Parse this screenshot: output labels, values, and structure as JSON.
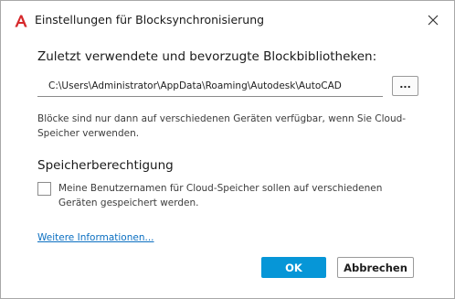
{
  "window": {
    "title": "Einstellungen für Blocksynchronisierung",
    "app_icon": "autocad-a-icon",
    "close_icon": "close-icon"
  },
  "library": {
    "heading": "Zuletzt verwendete und bevorzugte Blockbibliotheken:",
    "path_value": "C:\\Users\\Administrator\\AppData\\Roaming\\Autodesk\\AutoCAD",
    "browse_label": "...",
    "info": "Blöcke sind nur dann auf verschiedenen Geräten verfügbar, wenn Sie Cloud-Speicher verwenden."
  },
  "permission": {
    "heading": "Speicherberechtigung",
    "checkbox_label": "Meine Benutzernamen für Cloud-Speicher sollen auf verschiedenen Geräten gespeichert werden.",
    "checked": false
  },
  "more_info_link": "Weitere Informationen...",
  "buttons": {
    "ok": "OK",
    "cancel": "Abbrechen"
  },
  "colors": {
    "accent": "#0696d7",
    "link": "#0b6fc1",
    "app_icon_red": "#d6282b"
  }
}
